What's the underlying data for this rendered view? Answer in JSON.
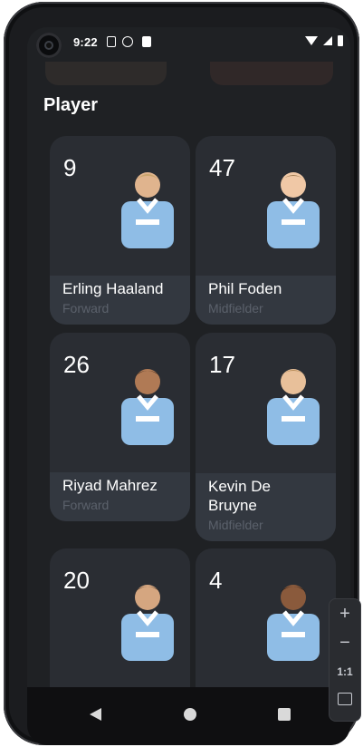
{
  "status_bar": {
    "time": "9:22"
  },
  "section_title": "Player",
  "players": [
    {
      "number": "9",
      "name": "Erling Haaland",
      "position": "Forward"
    },
    {
      "number": "47",
      "name": "Phil Foden",
      "position": "Midfielder"
    },
    {
      "number": "26",
      "name": "Riyad Mahrez",
      "position": "Forward"
    },
    {
      "number": "17",
      "name": "Kevin De Bruyne",
      "position": "Midfielder"
    },
    {
      "number": "20",
      "name": "",
      "position": ""
    },
    {
      "number": "4",
      "name": "",
      "position": ""
    }
  ],
  "zoom_controls": {
    "zoom_in": "+",
    "zoom_out": "−",
    "ratio": "1:1"
  },
  "colors": {
    "background": "#1f2124",
    "card": "#2a2d33",
    "card_footer": "#333840",
    "shirt": "#8fbde6",
    "muted_text": "#5b616b"
  },
  "icons": [
    "camera-icon",
    "wifi-icon",
    "signal-icon",
    "battery-icon",
    "back-icon",
    "home-icon",
    "recents-icon"
  ]
}
